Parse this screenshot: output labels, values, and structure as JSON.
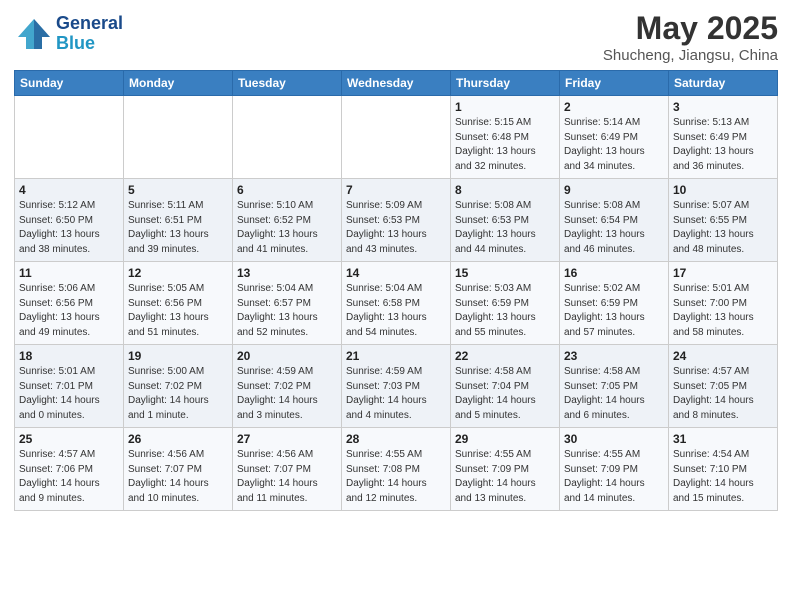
{
  "logo": {
    "line1": "General",
    "line2": "Blue"
  },
  "title": "May 2025",
  "subtitle": "Shucheng, Jiangsu, China",
  "weekdays": [
    "Sunday",
    "Monday",
    "Tuesday",
    "Wednesday",
    "Thursday",
    "Friday",
    "Saturday"
  ],
  "weeks": [
    [
      {
        "day": "",
        "info": ""
      },
      {
        "day": "",
        "info": ""
      },
      {
        "day": "",
        "info": ""
      },
      {
        "day": "",
        "info": ""
      },
      {
        "day": "1",
        "info": "Sunrise: 5:15 AM\nSunset: 6:48 PM\nDaylight: 13 hours\nand 32 minutes."
      },
      {
        "day": "2",
        "info": "Sunrise: 5:14 AM\nSunset: 6:49 PM\nDaylight: 13 hours\nand 34 minutes."
      },
      {
        "day": "3",
        "info": "Sunrise: 5:13 AM\nSunset: 6:49 PM\nDaylight: 13 hours\nand 36 minutes."
      }
    ],
    [
      {
        "day": "4",
        "info": "Sunrise: 5:12 AM\nSunset: 6:50 PM\nDaylight: 13 hours\nand 38 minutes."
      },
      {
        "day": "5",
        "info": "Sunrise: 5:11 AM\nSunset: 6:51 PM\nDaylight: 13 hours\nand 39 minutes."
      },
      {
        "day": "6",
        "info": "Sunrise: 5:10 AM\nSunset: 6:52 PM\nDaylight: 13 hours\nand 41 minutes."
      },
      {
        "day": "7",
        "info": "Sunrise: 5:09 AM\nSunset: 6:53 PM\nDaylight: 13 hours\nand 43 minutes."
      },
      {
        "day": "8",
        "info": "Sunrise: 5:08 AM\nSunset: 6:53 PM\nDaylight: 13 hours\nand 44 minutes."
      },
      {
        "day": "9",
        "info": "Sunrise: 5:08 AM\nSunset: 6:54 PM\nDaylight: 13 hours\nand 46 minutes."
      },
      {
        "day": "10",
        "info": "Sunrise: 5:07 AM\nSunset: 6:55 PM\nDaylight: 13 hours\nand 48 minutes."
      }
    ],
    [
      {
        "day": "11",
        "info": "Sunrise: 5:06 AM\nSunset: 6:56 PM\nDaylight: 13 hours\nand 49 minutes."
      },
      {
        "day": "12",
        "info": "Sunrise: 5:05 AM\nSunset: 6:56 PM\nDaylight: 13 hours\nand 51 minutes."
      },
      {
        "day": "13",
        "info": "Sunrise: 5:04 AM\nSunset: 6:57 PM\nDaylight: 13 hours\nand 52 minutes."
      },
      {
        "day": "14",
        "info": "Sunrise: 5:04 AM\nSunset: 6:58 PM\nDaylight: 13 hours\nand 54 minutes."
      },
      {
        "day": "15",
        "info": "Sunrise: 5:03 AM\nSunset: 6:59 PM\nDaylight: 13 hours\nand 55 minutes."
      },
      {
        "day": "16",
        "info": "Sunrise: 5:02 AM\nSunset: 6:59 PM\nDaylight: 13 hours\nand 57 minutes."
      },
      {
        "day": "17",
        "info": "Sunrise: 5:01 AM\nSunset: 7:00 PM\nDaylight: 13 hours\nand 58 minutes."
      }
    ],
    [
      {
        "day": "18",
        "info": "Sunrise: 5:01 AM\nSunset: 7:01 PM\nDaylight: 14 hours\nand 0 minutes."
      },
      {
        "day": "19",
        "info": "Sunrise: 5:00 AM\nSunset: 7:02 PM\nDaylight: 14 hours\nand 1 minute."
      },
      {
        "day": "20",
        "info": "Sunrise: 4:59 AM\nSunset: 7:02 PM\nDaylight: 14 hours\nand 3 minutes."
      },
      {
        "day": "21",
        "info": "Sunrise: 4:59 AM\nSunset: 7:03 PM\nDaylight: 14 hours\nand 4 minutes."
      },
      {
        "day": "22",
        "info": "Sunrise: 4:58 AM\nSunset: 7:04 PM\nDaylight: 14 hours\nand 5 minutes."
      },
      {
        "day": "23",
        "info": "Sunrise: 4:58 AM\nSunset: 7:05 PM\nDaylight: 14 hours\nand 6 minutes."
      },
      {
        "day": "24",
        "info": "Sunrise: 4:57 AM\nSunset: 7:05 PM\nDaylight: 14 hours\nand 8 minutes."
      }
    ],
    [
      {
        "day": "25",
        "info": "Sunrise: 4:57 AM\nSunset: 7:06 PM\nDaylight: 14 hours\nand 9 minutes."
      },
      {
        "day": "26",
        "info": "Sunrise: 4:56 AM\nSunset: 7:07 PM\nDaylight: 14 hours\nand 10 minutes."
      },
      {
        "day": "27",
        "info": "Sunrise: 4:56 AM\nSunset: 7:07 PM\nDaylight: 14 hours\nand 11 minutes."
      },
      {
        "day": "28",
        "info": "Sunrise: 4:55 AM\nSunset: 7:08 PM\nDaylight: 14 hours\nand 12 minutes."
      },
      {
        "day": "29",
        "info": "Sunrise: 4:55 AM\nSunset: 7:09 PM\nDaylight: 14 hours\nand 13 minutes."
      },
      {
        "day": "30",
        "info": "Sunrise: 4:55 AM\nSunset: 7:09 PM\nDaylight: 14 hours\nand 14 minutes."
      },
      {
        "day": "31",
        "info": "Sunrise: 4:54 AM\nSunset: 7:10 PM\nDaylight: 14 hours\nand 15 minutes."
      }
    ]
  ]
}
